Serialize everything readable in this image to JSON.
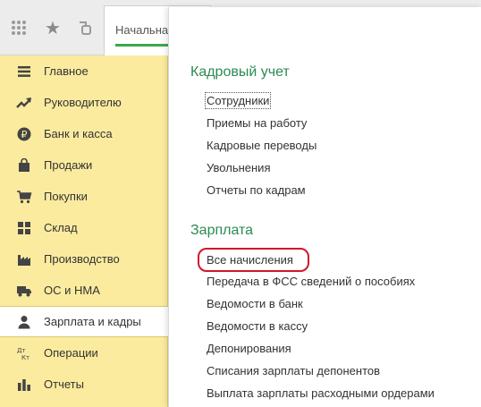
{
  "topbar": {
    "tab_label": "Начальна"
  },
  "sidebar": {
    "items": [
      {
        "label": "Главное",
        "icon": "menu-icon"
      },
      {
        "label": "Руководителю",
        "icon": "trend-up-icon"
      },
      {
        "label": "Банк и касса",
        "icon": "ruble-coin-icon"
      },
      {
        "label": "Продажи",
        "icon": "shopping-bag-icon"
      },
      {
        "label": "Покупки",
        "icon": "shopping-cart-icon"
      },
      {
        "label": "Склад",
        "icon": "warehouse-grid-icon"
      },
      {
        "label": "Производство",
        "icon": "factory-icon"
      },
      {
        "label": "ОС и НМА",
        "icon": "truck-icon"
      },
      {
        "label": "Зарплата и кадры",
        "icon": "person-icon"
      },
      {
        "label": "Операции",
        "icon": "debit-credit-icon"
      },
      {
        "label": "Отчеты",
        "icon": "bar-chart-icon"
      }
    ],
    "active_index": 8
  },
  "panel": {
    "sections": [
      {
        "title": "Кадровый учет",
        "links": [
          "Сотрудники",
          "Приемы на работу",
          "Кадровые переводы",
          "Увольнения",
          "Отчеты по кадрам"
        ]
      },
      {
        "title": "Зарплата",
        "links": [
          "Все начисления",
          "Передача в ФСС сведений о пособиях",
          "Ведомости в банк",
          "Ведомости в кассу",
          "Депонирования",
          "Списания зарплаты депонентов",
          "Выплата зарплаты расходными ордерами"
        ]
      }
    ]
  },
  "colors": {
    "sidebar_bg": "#fbeb9f",
    "section_title": "#2c8a53",
    "highlight": "#d0182a",
    "tab_accent": "#3aa84a"
  }
}
